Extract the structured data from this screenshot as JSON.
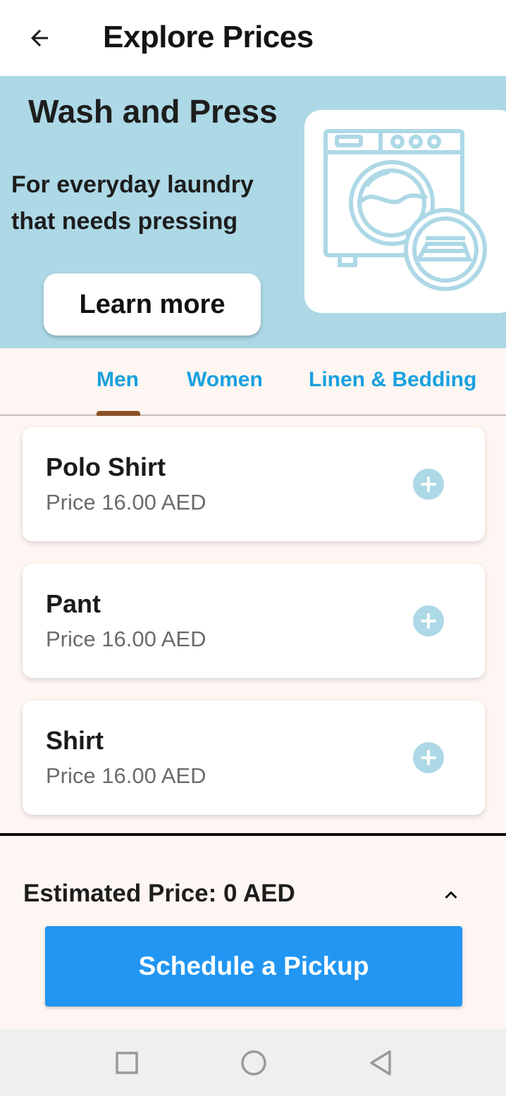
{
  "header": {
    "title": "Explore Prices",
    "back_icon": "arrow-back-icon"
  },
  "hero": {
    "title": "Wash and Press",
    "subtitle": "For everyday laundry that needs pressing",
    "learn_more_label": "Learn more",
    "illustration_icon": "washing-machine-icon",
    "background_color": "#add8e6"
  },
  "tabs": {
    "items": [
      {
        "label": "Men",
        "selected": true
      },
      {
        "label": "Women",
        "selected": false
      },
      {
        "label": "Linen & Bedding",
        "selected": false
      }
    ],
    "active_color": "#1aa0e0",
    "indicator_color": "#8a4f24"
  },
  "items": [
    {
      "name": "Polo Shirt",
      "price": "Price 16.00 AED"
    },
    {
      "name": "Pant",
      "price": "Price 16.00 AED"
    },
    {
      "name": "Shirt",
      "price": "Price 16.00 AED"
    }
  ],
  "summary": {
    "estimated_price": "Estimated Price: 0 AED",
    "expand_icon": "chevron-up-icon",
    "schedule_label": "Schedule a Pickup",
    "button_color": "#2196f3"
  },
  "system_nav": {
    "icons": [
      "square-recents-icon",
      "circle-home-icon",
      "triangle-back-icon"
    ]
  }
}
